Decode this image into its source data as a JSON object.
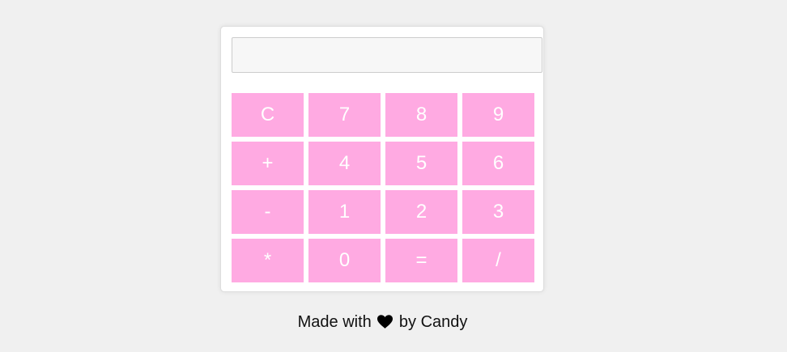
{
  "calculator": {
    "display_value": "",
    "keys": [
      {
        "label": "C",
        "name": "clear-button"
      },
      {
        "label": "7",
        "name": "digit-7-button"
      },
      {
        "label": "8",
        "name": "digit-8-button"
      },
      {
        "label": "9",
        "name": "digit-9-button"
      },
      {
        "label": "+",
        "name": "add-button"
      },
      {
        "label": "4",
        "name": "digit-4-button"
      },
      {
        "label": "5",
        "name": "digit-5-button"
      },
      {
        "label": "6",
        "name": "digit-6-button"
      },
      {
        "label": "-",
        "name": "subtract-button"
      },
      {
        "label": "1",
        "name": "digit-1-button"
      },
      {
        "label": "2",
        "name": "digit-2-button"
      },
      {
        "label": "3",
        "name": "digit-3-button"
      },
      {
        "label": "*",
        "name": "multiply-button"
      },
      {
        "label": "0",
        "name": "digit-0-button"
      },
      {
        "label": "=",
        "name": "equals-button"
      },
      {
        "label": "/",
        "name": "divide-button"
      }
    ]
  },
  "footer": {
    "prefix": "Made with",
    "icon": "heart-icon",
    "suffix": "by Candy"
  },
  "colors": {
    "key_background": "#ffaae2",
    "key_text": "#ffffff",
    "page_background": "#f0f0f0"
  }
}
